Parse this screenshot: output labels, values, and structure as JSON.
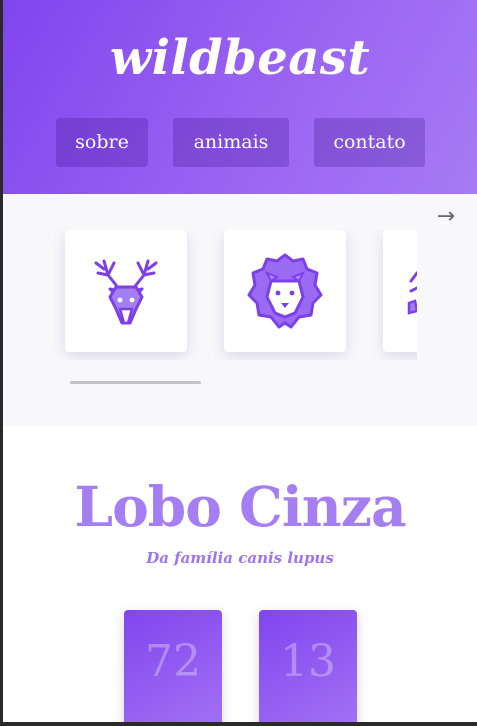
{
  "header": {
    "logo": "wildbeast",
    "nav": [
      {
        "label": "sobre"
      },
      {
        "label": "animais"
      },
      {
        "label": "contato"
      }
    ]
  },
  "carousel": {
    "next_arrow": "→",
    "cards": [
      {
        "icon": "deer-icon"
      },
      {
        "icon": "lion-icon"
      },
      {
        "icon": "partial-animal-icon"
      }
    ]
  },
  "animal": {
    "title": "Lobo Cinza",
    "subtitle": "Da família canis lupus",
    "stats": [
      {
        "value": "72"
      },
      {
        "value": "13"
      }
    ]
  },
  "colors": {
    "accent": "#8145ee",
    "accent_light": "#a57ff2",
    "carousel_bg": "#f8f8fb"
  }
}
